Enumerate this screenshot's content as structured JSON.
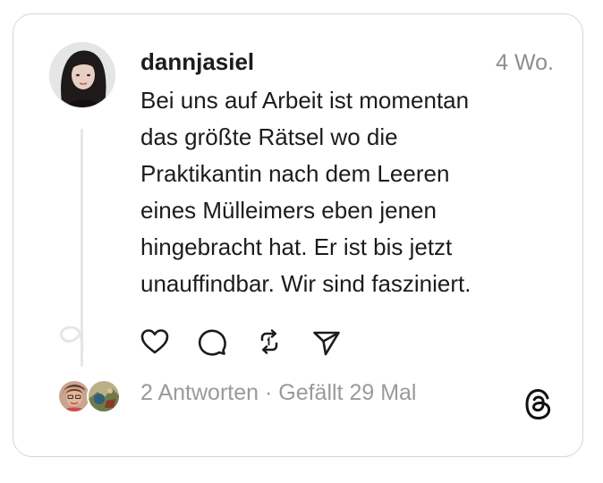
{
  "post": {
    "username": "dannjasiel",
    "time": "4 Wo.",
    "text_lines": [
      "Bei uns auf Arbeit ist momentan",
      "das größte Rätsel wo die",
      "Praktikantin nach dem Leeren",
      "eines Mülleimers eben jenen",
      "hingebracht hat. Er ist bis jetzt",
      "unauffindbar. Wir sind fasziniert."
    ]
  },
  "actions": {
    "like_icon": "heart-icon",
    "comment_icon": "comment-bubble-icon",
    "repost_icon": "repost-icon",
    "share_icon": "send-icon"
  },
  "footer": {
    "replies": "2 Antworten",
    "separator": " · ",
    "likes": "Gefällt 29 Mal",
    "logo_icon": "threads-logo-icon"
  },
  "colors": {
    "text": "#1c1c1c",
    "muted": "#9a9a9a",
    "border": "#d6d6d6",
    "thread_line": "#e6e6e6"
  }
}
